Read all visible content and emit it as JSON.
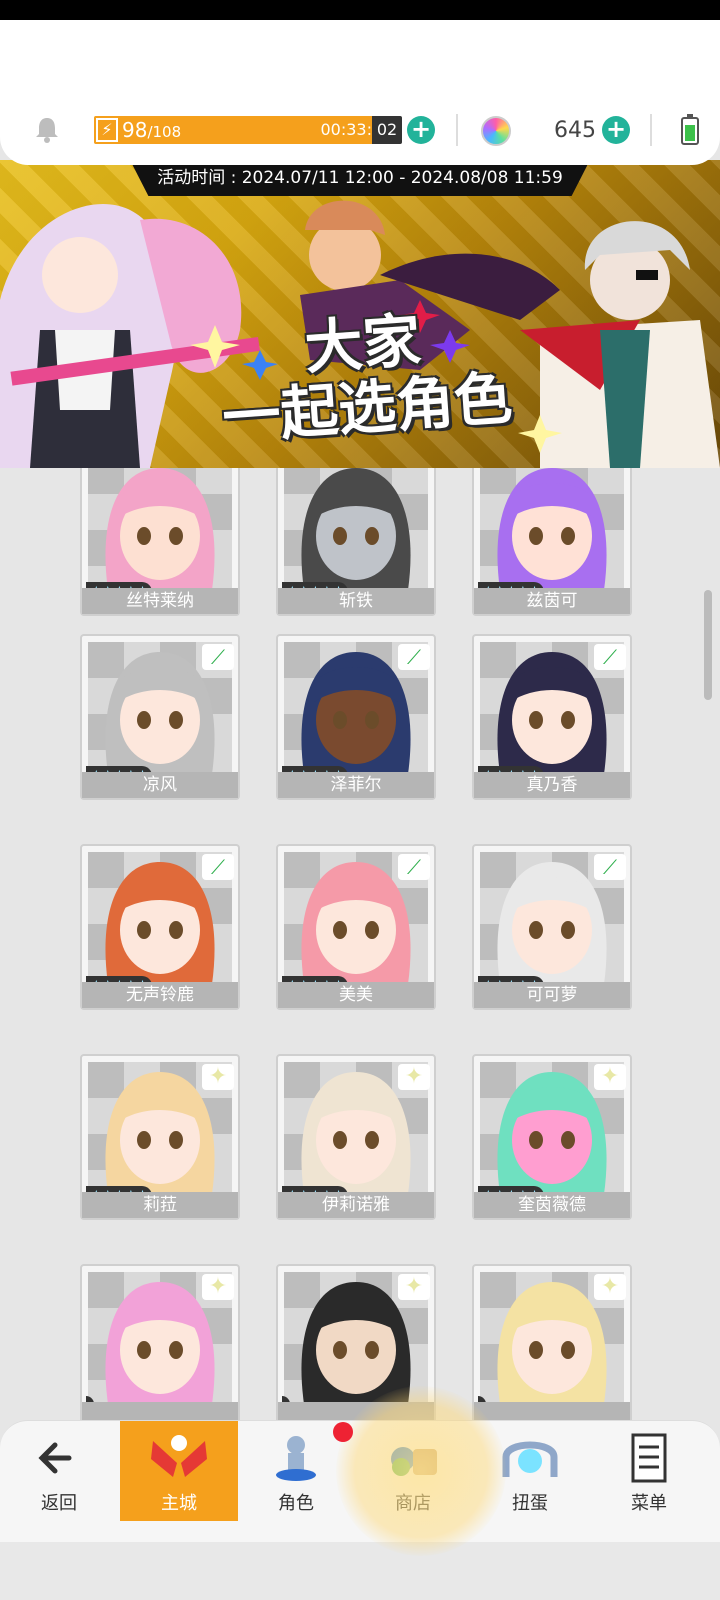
{
  "status": {
    "energy_current": "98",
    "energy_max": "/108",
    "energy_fraction": 0.907,
    "energy_timer": "00:33:",
    "energy_timer_tail": "02",
    "gem_count": "645",
    "icons": [
      "bell-icon",
      "energy-icon",
      "plus-icon",
      "gem-icon",
      "battery-icon"
    ]
  },
  "banner": {
    "event_time": "活动时间 : 2024.07/11 12:00 - 2024.08/08 11:59",
    "title_line1": "大家",
    "title_line2": "一起选角色"
  },
  "characters": [
    {
      "name": "丝特莱纳",
      "stars": "★★★★★",
      "tag": "none"
    },
    {
      "name": "斩铁",
      "stars": "★★★★★",
      "tag": "none"
    },
    {
      "name": "兹茵可",
      "stars": "★★★★★",
      "tag": "none"
    },
    {
      "name": "凉风",
      "stars": "★★★★★",
      "tag": "leaf"
    },
    {
      "name": "泽菲尔",
      "stars": "★★★★★",
      "tag": "leaf"
    },
    {
      "name": "真乃香",
      "stars": "★★★★★",
      "tag": "leaf"
    },
    {
      "name": "无声铃鹿",
      "stars": "★★★★★",
      "tag": "leaf"
    },
    {
      "name": "美美",
      "stars": "★★★★★",
      "tag": "leaf"
    },
    {
      "name": "可可萝",
      "stars": "★★★★★",
      "tag": "leaf"
    },
    {
      "name": "莉菈",
      "stars": "★★★★★",
      "tag": "star"
    },
    {
      "name": "伊莉诺雅",
      "stars": "★★★★★",
      "tag": "star"
    },
    {
      "name": "奎茵薇德",
      "stars": "★★★★★",
      "tag": "star"
    },
    {
      "name": "",
      "stars": "",
      "tag": "star"
    },
    {
      "name": "",
      "stars": "",
      "tag": "star"
    },
    {
      "name": "",
      "stars": "",
      "tag": "star"
    }
  ],
  "tag_glyphs": {
    "leaf": "⟋",
    "star": "✦",
    "none": ""
  },
  "nav": {
    "back": "返回",
    "main_city": "主城",
    "character": "角色",
    "shop": "商店",
    "gacha": "扭蛋",
    "menu": "菜单",
    "character_badge": ""
  }
}
